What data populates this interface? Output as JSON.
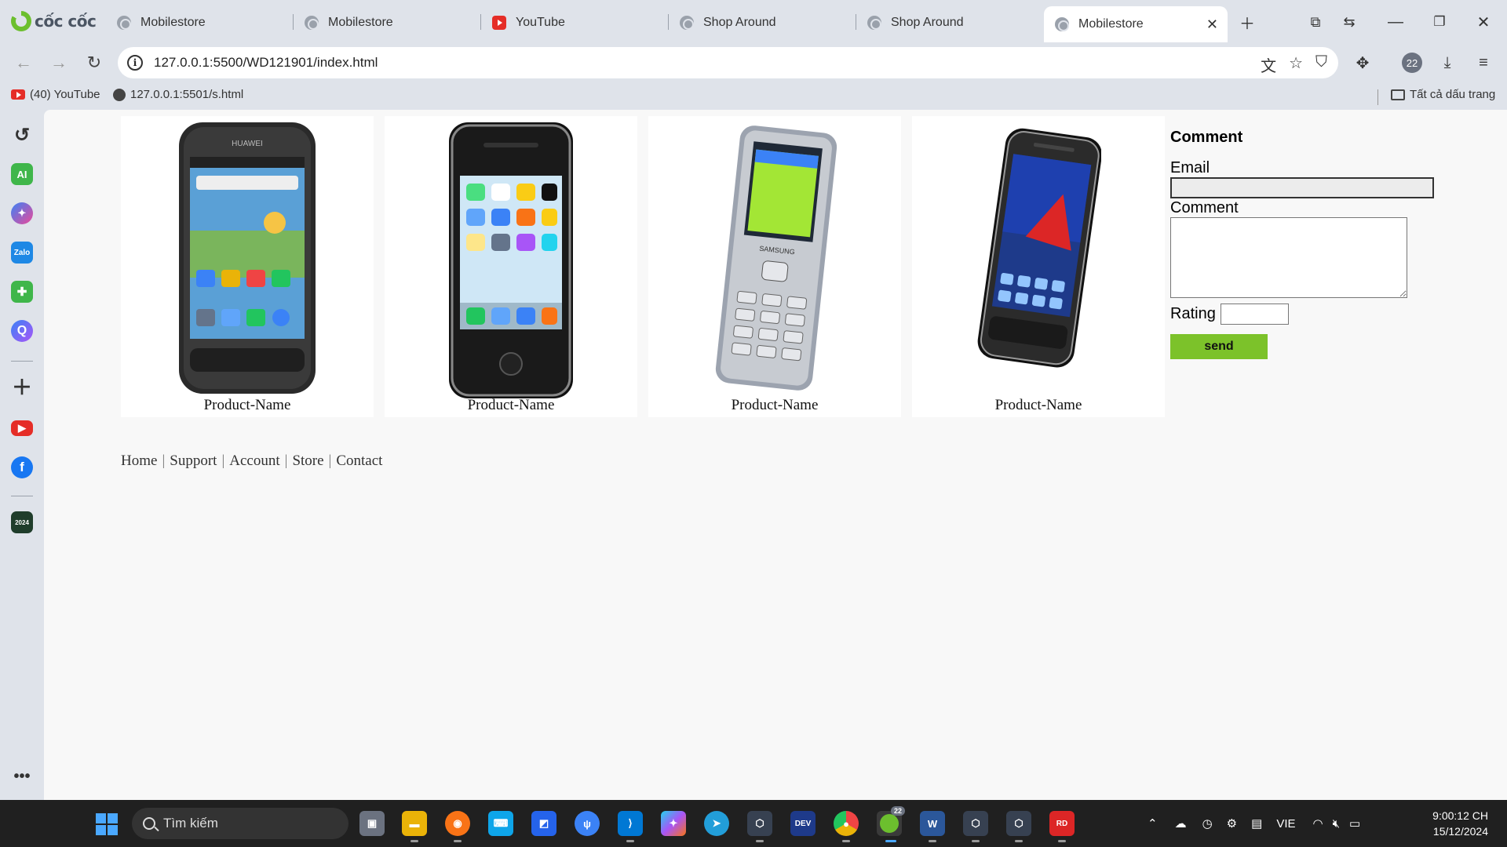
{
  "browser": {
    "logo_text": "cốc cốc",
    "tabs": [
      {
        "title": "Mobilestore",
        "icon": "globe-icon"
      },
      {
        "title": "Mobilestore",
        "icon": "globe-icon"
      },
      {
        "title": "YouTube",
        "icon": "youtube-icon"
      },
      {
        "title": "Shop Around",
        "icon": "globe-icon"
      },
      {
        "title": "Shop Around",
        "icon": "globe-icon"
      },
      {
        "title": "Mobilestore",
        "icon": "globe-icon",
        "active": true
      }
    ],
    "url": "127.0.0.1:5500/WD121901/index.html",
    "profile_count": "22",
    "bookmarks": [
      {
        "label": "(40) YouTube"
      },
      {
        "label": "127.0.0.1:5501/s.html"
      }
    ],
    "all_bookmarks_label": "Tất cả dấu trang",
    "sidebar_icons": [
      "history-icon",
      "ai-icon",
      "messenger-icon",
      "zalo-icon",
      "game-icon",
      "q-icon",
      "plus-icon",
      "youtube-icon",
      "facebook-icon",
      "coccoc-2024-icon",
      "more-icon"
    ]
  },
  "page": {
    "products": [
      {
        "name": "Product-Name",
        "image": "huawei-phone"
      },
      {
        "name": "Product-Name",
        "image": "iphone-4"
      },
      {
        "name": "Product-Name",
        "image": "samsung-feature-phone"
      },
      {
        "name": "Product-Name",
        "image": "blackberry-storm"
      }
    ],
    "comment_form": {
      "title": "Comment",
      "email_label": "Email",
      "comment_label": "Comment",
      "rating_label": "Rating",
      "send_label": "send"
    },
    "footer_links": [
      "Home",
      "Support",
      "Account",
      "Store",
      "Contact"
    ],
    "accent_color": "#7cc22a"
  },
  "taskbar": {
    "search_placeholder": "Tìm kiếm",
    "language": "VIE",
    "time": "9:00:12 CH",
    "date": "15/12/2024",
    "coccoc_badge": "22"
  }
}
